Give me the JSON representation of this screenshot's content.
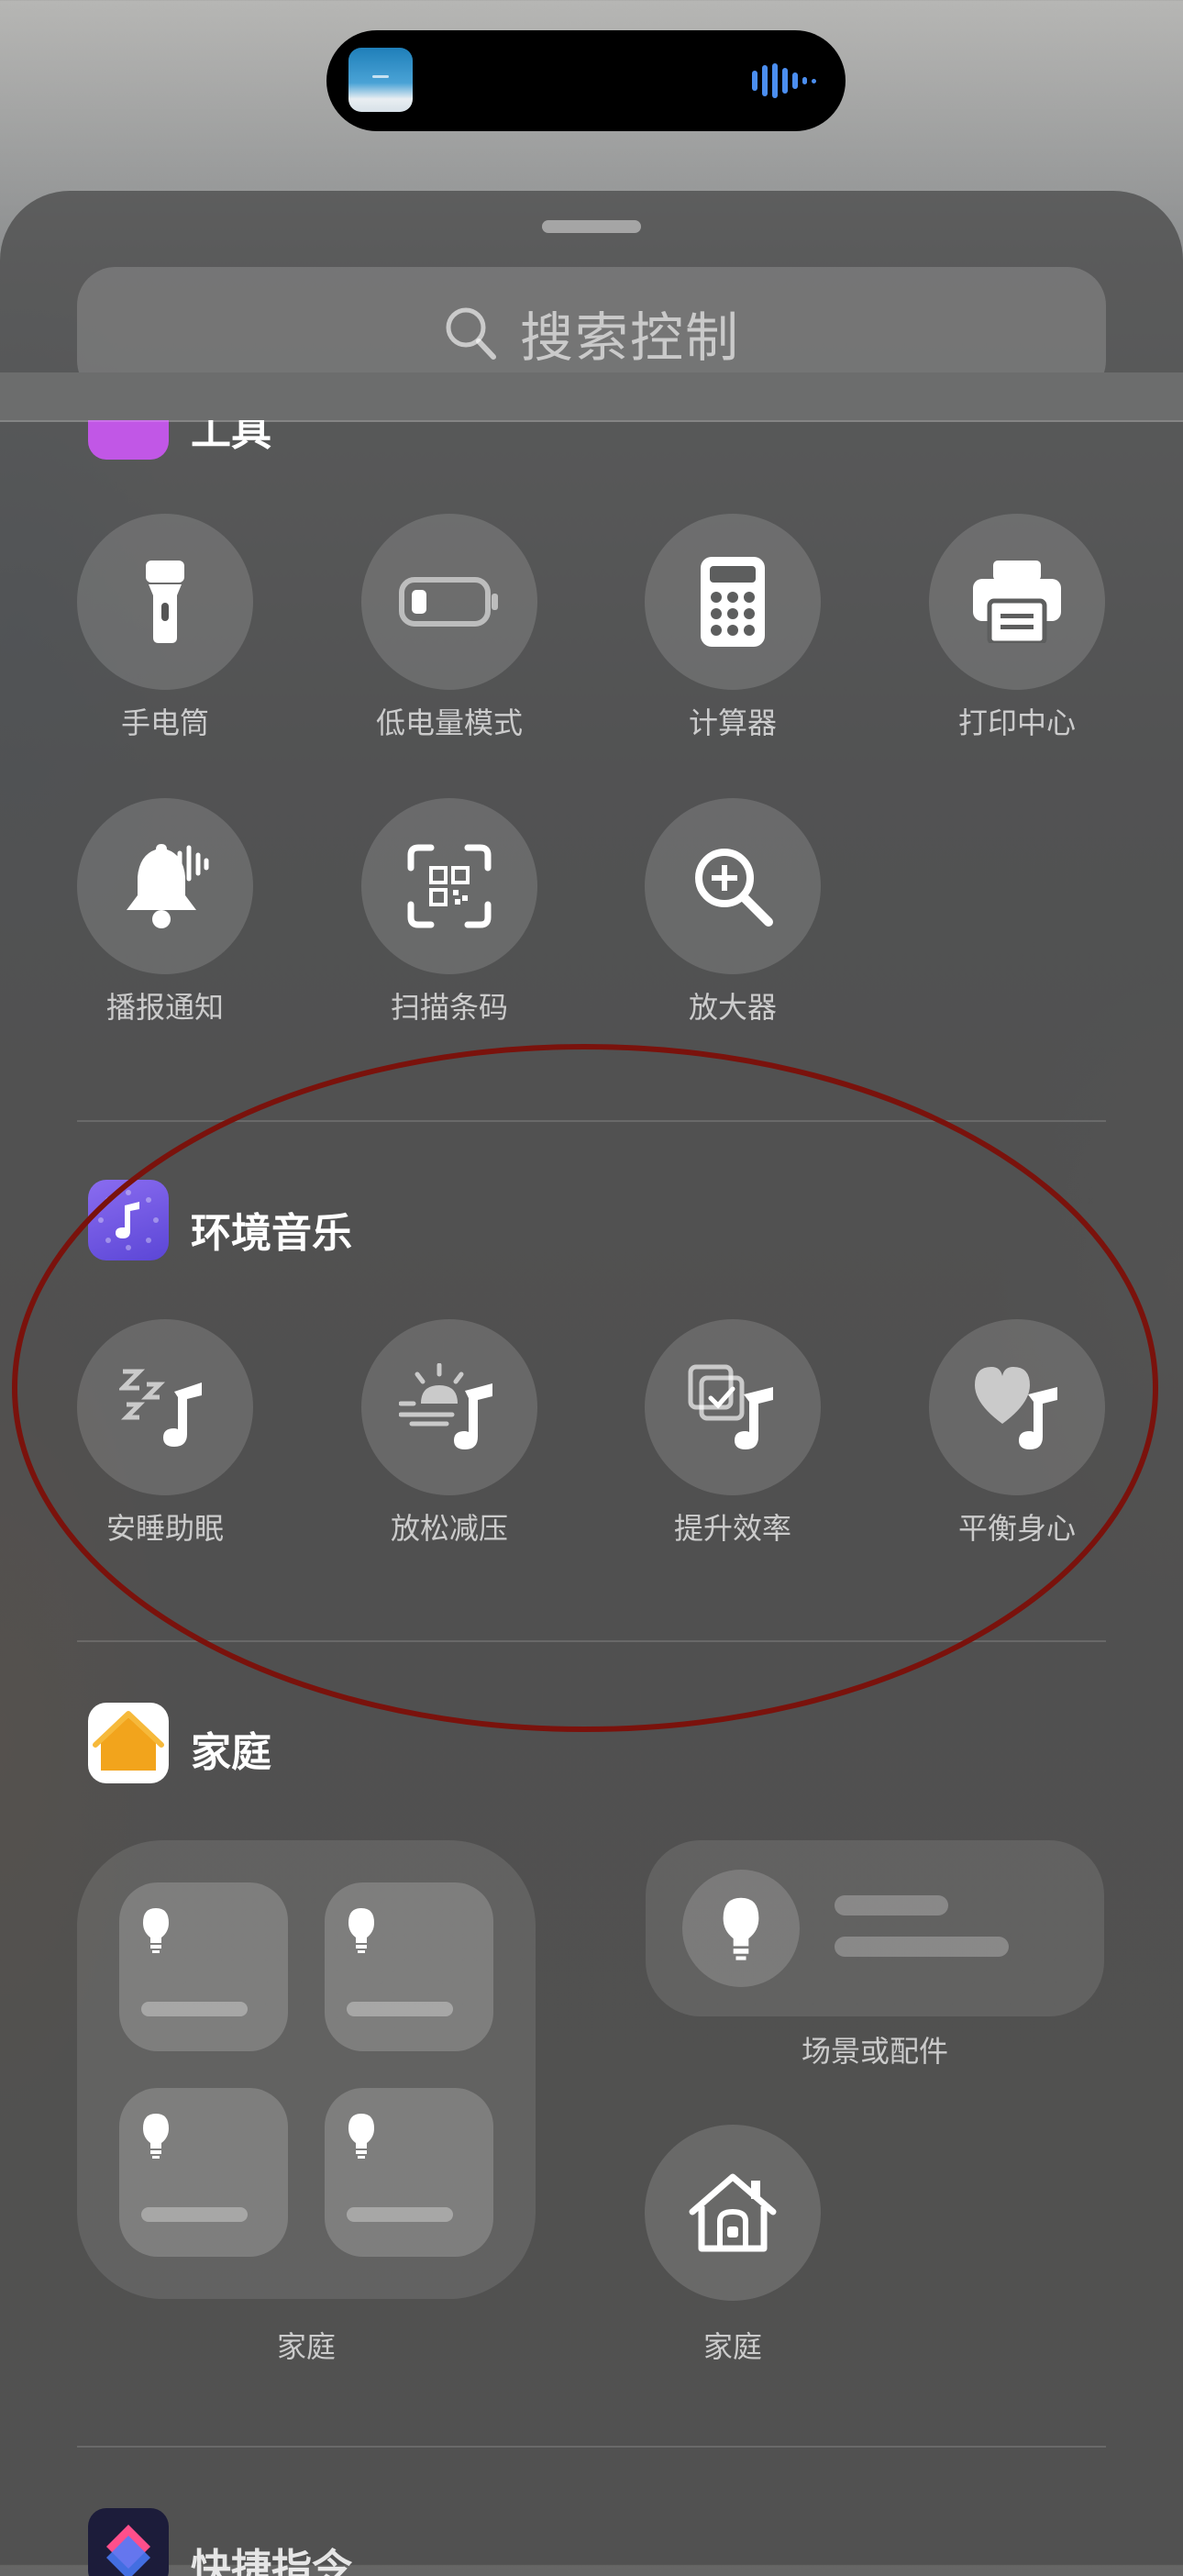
{
  "search": {
    "placeholder": "搜索控制"
  },
  "sections": {
    "tools": {
      "title": "工具",
      "items": [
        "手电筒",
        "低电量模式",
        "计算器",
        "打印中心",
        "播报通知",
        "扫描条码",
        "放大器"
      ]
    },
    "ambient": {
      "title": "环境音乐",
      "items": [
        "安睡助眠",
        "放松减压",
        "提升效率",
        "平衡身心"
      ]
    },
    "home": {
      "title": "家庭",
      "big_tile_label": "家庭",
      "scene_label": "场景或配件",
      "home_button_label": "家庭"
    },
    "shortcuts": {
      "title": "快捷指令"
    }
  },
  "icons": {
    "island": [
      "artwork-thumbnail",
      "audio-waveform-icon"
    ],
    "tools": [
      "flashlight-icon",
      "battery-icon",
      "calculator-icon",
      "printer-icon",
      "announce-bell-icon",
      "qr-scan-icon",
      "magnifier-icon"
    ],
    "ambient": [
      "sleep-music-icon",
      "sunrise-music-icon",
      "productivity-music-icon",
      "heart-music-icon"
    ],
    "home": [
      "bulb-icon",
      "home-icon"
    ]
  },
  "colors": {
    "tools_app": "#c157e6",
    "ambient_app": "#6d57e0",
    "home_app_bg": "#ffffff",
    "home_app_house": "#f2a41c",
    "annotation_ellipse": "#7a120c",
    "island_wave": "#4b8ef0"
  }
}
